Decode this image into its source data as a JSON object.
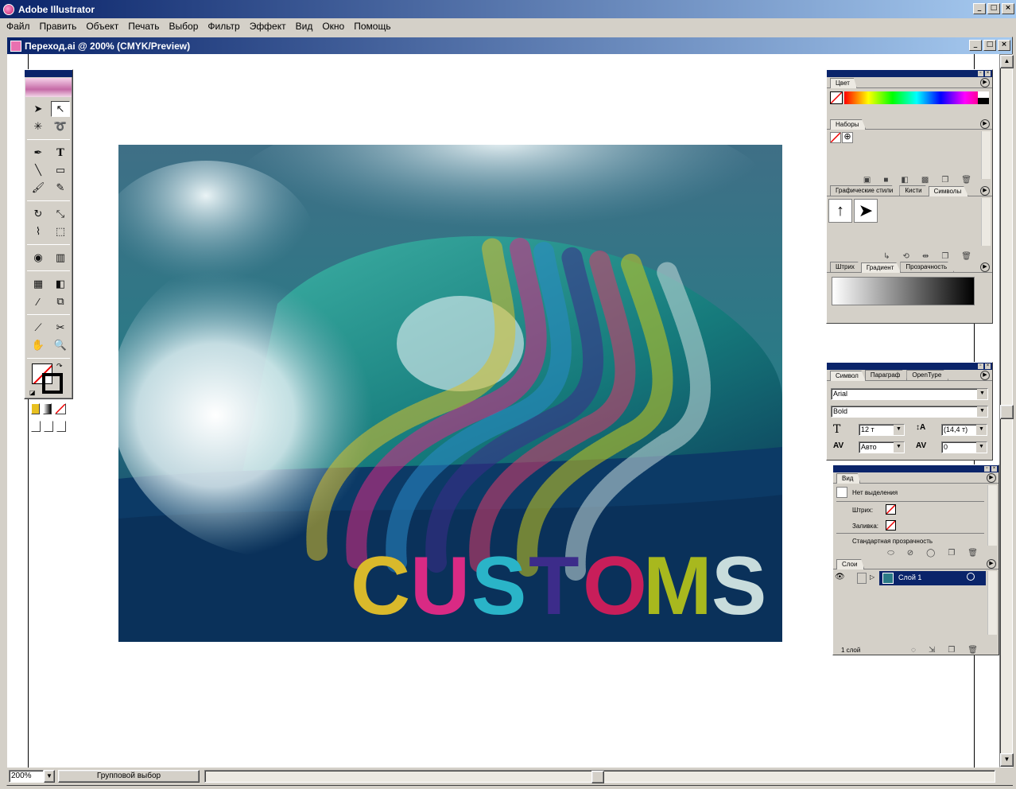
{
  "app": {
    "title": "Adobe Illustrator"
  },
  "window_buttons": {
    "minimize": "_",
    "maximize": "□",
    "close": "×"
  },
  "menu": [
    "Файл",
    "Править",
    "Объект",
    "Печать",
    "Выбор",
    "Фильтр",
    "Эффект",
    "Вид",
    "Окно",
    "Помощь"
  ],
  "document": {
    "title": "Переход.ai @ 200% (CMYK/Preview)"
  },
  "status": {
    "zoom": "200%",
    "tool": "Групповой выбор"
  },
  "artwork": {
    "text": "CUSTOMS",
    "letters": [
      {
        "char": "C",
        "color": "#d9b92b"
      },
      {
        "char": "U",
        "color": "#d92a84"
      },
      {
        "char": "S",
        "color": "#2ab4c8"
      },
      {
        "char": "T",
        "color": "#3c2c8a"
      },
      {
        "char": "O",
        "color": "#c81e5a"
      },
      {
        "char": "M",
        "color": "#a8b81e"
      },
      {
        "char": "S",
        "color": "#c8dcdc"
      }
    ],
    "ribbon_colors": [
      "#d9c02a",
      "#d92a84",
      "#2a8ac8",
      "#3c2c8a",
      "#d93a6a",
      "#c8c81e",
      "#c8dcdc"
    ]
  },
  "panels": {
    "color": {
      "tabs": [
        "Цвет"
      ]
    },
    "swatches": {
      "tabs": [
        "Наборы"
      ]
    },
    "styles": {
      "tabs": [
        "Графические стили",
        "Кисти",
        "Символы"
      ]
    },
    "stroke_gradient": {
      "tabs": [
        "Штрих",
        "Градиент",
        "Прозрачность"
      ]
    },
    "character": {
      "tabs": [
        "Символ",
        "Параграф",
        "OpenType"
      ],
      "font_family": "Arial",
      "font_style": "Bold",
      "size": "12 т",
      "leading": "(14,4 т)",
      "kerning": "Авто",
      "tracking": "0"
    },
    "appearance": {
      "tabs": [
        "Вид"
      ],
      "selection": "Нет выделения",
      "stroke_label": "Штрих:",
      "fill_label": "Заливка:",
      "transparency": "Стандартная прозрачность"
    },
    "layers": {
      "tabs": [
        "Слои"
      ],
      "layer_name": "Слой 1",
      "count": "1 слой"
    }
  }
}
